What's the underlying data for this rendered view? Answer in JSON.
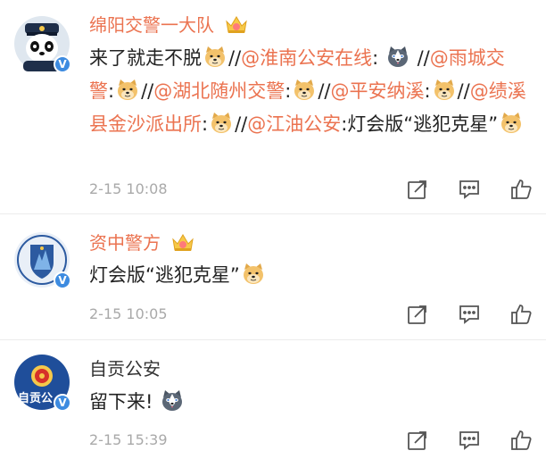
{
  "comments": [
    {
      "name": "绵阳交警一大队",
      "avatar_icon": "panda-police-avatar",
      "verified": "V",
      "segments": [
        {
          "type": "text",
          "text": "来了就走不脱"
        },
        {
          "type": "emoji",
          "icon": "doge-emoji"
        },
        {
          "type": "text",
          "text": "//"
        },
        {
          "type": "mention",
          "text": "@淮南公安在线"
        },
        {
          "type": "text",
          "text": ": "
        },
        {
          "type": "emoji",
          "icon": "husky-emoji"
        },
        {
          "type": "text",
          "text": " //"
        },
        {
          "type": "mention",
          "text": "@雨城交警"
        },
        {
          "type": "text",
          "text": ":"
        },
        {
          "type": "emoji",
          "icon": "doge-emoji"
        },
        {
          "type": "text",
          "text": "//"
        },
        {
          "type": "mention",
          "text": "@湖北随州交警"
        },
        {
          "type": "text",
          "text": ":"
        },
        {
          "type": "emoji",
          "icon": "doge-emoji"
        },
        {
          "type": "text",
          "text": "//"
        },
        {
          "type": "mention",
          "text": "@平安纳溪"
        },
        {
          "type": "text",
          "text": ":"
        },
        {
          "type": "emoji",
          "icon": "doge-emoji"
        },
        {
          "type": "text",
          "text": "//"
        },
        {
          "type": "mention",
          "text": "@绩溪县金沙派出所"
        },
        {
          "type": "text",
          "text": ":"
        },
        {
          "type": "emoji",
          "icon": "doge-emoji"
        },
        {
          "type": "text",
          "text": "//"
        },
        {
          "type": "mention",
          "text": "@江油公安"
        },
        {
          "type": "text",
          "text": ":灯会版“逃犯克星”"
        },
        {
          "type": "emoji",
          "icon": "doge-emoji"
        }
      ],
      "time": "2-15 10:08"
    },
    {
      "name": "资中警方",
      "avatar_icon": "police-badge-avatar",
      "verified": "V",
      "segments": [
        {
          "type": "text",
          "text": "灯会版“逃犯克星”"
        },
        {
          "type": "emoji",
          "icon": "doge-emoji"
        }
      ],
      "time": "2-15 10:05"
    },
    {
      "name": "自贡公安",
      "avatar_icon": "police-emblem-avatar",
      "avatar_text": "自贡公",
      "verified": "V",
      "segments": [
        {
          "type": "text",
          "text": "留下来!"
        },
        {
          "type": "emoji",
          "icon": "husky-emoji"
        }
      ],
      "time": "2-15 15:39"
    }
  ],
  "icons": {
    "crown": "crown-badge-icon",
    "share": "share-icon",
    "reply": "reply-icon",
    "like": "like-icon"
  },
  "colors": {
    "name": "#eb7350",
    "mention": "#eb7350",
    "verified": "#3d8be0",
    "time": "#a9a9a9"
  }
}
